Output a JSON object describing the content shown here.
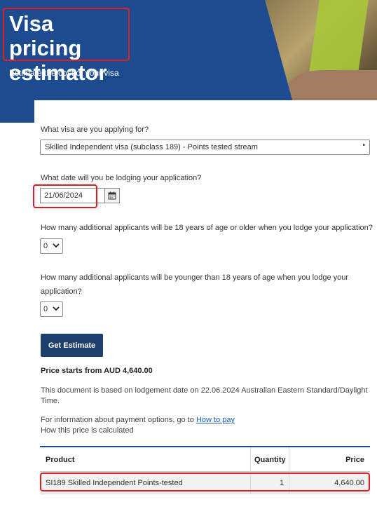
{
  "header": {
    "title_line1": "Visa pricing",
    "title_line2": "estimator",
    "subtitle": "Estimate the cost of your visa"
  },
  "form": {
    "q_visa": "What visa are you applying for?",
    "visa_selected": "Skilled Independent visa (subclass 189) - Points tested stream",
    "q_date": "What date will you be lodging your application?",
    "date_value": "21/06/2024",
    "q_adults": "How many additional applicants will be 18 years of age or older when you lodge your application?",
    "adults_value": "0",
    "q_minors_line1": "How many additional applicants will be younger than 18 years of age when you lodge your",
    "q_minors_line2": "application?",
    "minors_value": "0",
    "estimate_button": "Get Estimate"
  },
  "result": {
    "price_starts": "Price starts from AUD 4,640.00",
    "doc_note": "This document is based on lodgement date on 22.06.2024 Australian Eastern Standard/Daylight Time.",
    "pay_prefix": "For information about payment options, go to",
    "pay_link": "How to pay",
    "how_calculated": "How this price is calculated"
  },
  "table": {
    "headers": {
      "product": "Product",
      "quantity": "Quantity",
      "price": "Price"
    },
    "rows": [
      {
        "product": "SI189 Skilled Independent Points-tested",
        "quantity": "1",
        "price": "4,640.00"
      }
    ]
  },
  "icons": {
    "calendar": "calendar-icon",
    "chevron": "chevron-down-icon",
    "caret": "dropdown-caret-icon"
  },
  "colors": {
    "banner": "#1d4b8f",
    "button": "#1d3f6e",
    "highlight": "#e02020",
    "link": "#1a5fb4"
  }
}
